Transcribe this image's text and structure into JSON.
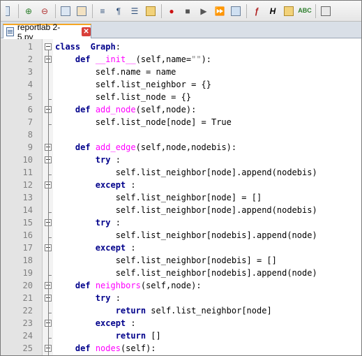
{
  "tab": {
    "filename": "reportlab 2-5.py",
    "close_glyph": "✕"
  },
  "toolbar_icons": [
    "save-all-icon",
    "zoom-in-icon",
    "zoom-out-icon",
    "sync-vertical-icon",
    "sync-horizontal-icon",
    "word-wrap-icon",
    "show-symbols-icon",
    "indent-guide-icon",
    "folder-icon",
    "record-macro-icon",
    "stop-macro-icon",
    "play-macro-icon",
    "run-macro-multiple-icon",
    "save-macro-icon",
    "function-list-icon",
    "highlight-icon",
    "open-folder-icon",
    "spellcheck-icon",
    "print-icon"
  ],
  "colors": {
    "keyword": "#00008b",
    "function": "#ff00ff",
    "string": "#808080",
    "gutter": "#e4e4e4",
    "accent_tab": "#f5a623"
  },
  "lines": [
    {
      "n": "1",
      "segs": [
        [
          "kw",
          "class"
        ],
        [
          "",
          "  "
        ],
        [
          "kw",
          "Graph"
        ],
        [
          "",
          ":"
        ]
      ]
    },
    {
      "n": "2",
      "segs": [
        [
          "",
          "    "
        ],
        [
          "kw",
          "def"
        ],
        [
          "",
          " "
        ],
        [
          "fn",
          "__init__"
        ],
        [
          "",
          "(self,name="
        ],
        [
          "st",
          "\"\""
        ],
        [
          "",
          "):"
        ]
      ]
    },
    {
      "n": "3",
      "segs": [
        [
          "",
          "        self.name = name"
        ]
      ]
    },
    {
      "n": "4",
      "segs": [
        [
          "",
          "        self.list_neighbor = {}"
        ]
      ]
    },
    {
      "n": "5",
      "segs": [
        [
          "",
          "        self.list_node = {}"
        ]
      ]
    },
    {
      "n": "6",
      "segs": [
        [
          "",
          "    "
        ],
        [
          "kw",
          "def"
        ],
        [
          "",
          " "
        ],
        [
          "fn",
          "add_node"
        ],
        [
          "",
          "(self,node):"
        ]
      ]
    },
    {
      "n": "7",
      "segs": [
        [
          "",
          "        self.list_node[node] = True"
        ]
      ]
    },
    {
      "n": "8",
      "segs": [
        [
          "",
          ""
        ]
      ]
    },
    {
      "n": "9",
      "segs": [
        [
          "",
          "    "
        ],
        [
          "kw",
          "def"
        ],
        [
          "",
          " "
        ],
        [
          "fn",
          "add_edge"
        ],
        [
          "",
          "(self,node,nodebis):"
        ]
      ]
    },
    {
      "n": "10",
      "segs": [
        [
          "",
          "        "
        ],
        [
          "kw",
          "try"
        ],
        [
          "",
          " :"
        ]
      ]
    },
    {
      "n": "11",
      "segs": [
        [
          "",
          "            self.list_neighbor[node].append(nodebis)"
        ]
      ]
    },
    {
      "n": "12",
      "segs": [
        [
          "",
          "        "
        ],
        [
          "kw",
          "except"
        ],
        [
          "",
          " :"
        ]
      ]
    },
    {
      "n": "13",
      "segs": [
        [
          "",
          "            self.list_neighbor[node] = []"
        ]
      ]
    },
    {
      "n": "14",
      "segs": [
        [
          "",
          "            self.list_neighbor[node].append(nodebis)"
        ]
      ]
    },
    {
      "n": "15",
      "segs": [
        [
          "",
          "        "
        ],
        [
          "kw",
          "try"
        ],
        [
          "",
          " :"
        ]
      ]
    },
    {
      "n": "16",
      "segs": [
        [
          "",
          "            self.list_neighbor[nodebis].append(node)"
        ]
      ]
    },
    {
      "n": "17",
      "segs": [
        [
          "",
          "        "
        ],
        [
          "kw",
          "except"
        ],
        [
          "",
          " :"
        ]
      ]
    },
    {
      "n": "18",
      "segs": [
        [
          "",
          "            self.list_neighbor[nodebis] = []"
        ]
      ]
    },
    {
      "n": "19",
      "segs": [
        [
          "",
          "            self.list_neighbor[nodebis].append(node)"
        ]
      ]
    },
    {
      "n": "20",
      "segs": [
        [
          "",
          "    "
        ],
        [
          "kw",
          "def"
        ],
        [
          "",
          " "
        ],
        [
          "fn",
          "neighbors"
        ],
        [
          "",
          "(self,node):"
        ]
      ]
    },
    {
      "n": "21",
      "segs": [
        [
          "",
          "        "
        ],
        [
          "kw",
          "try"
        ],
        [
          "",
          " :"
        ]
      ]
    },
    {
      "n": "22",
      "segs": [
        [
          "",
          "            "
        ],
        [
          "kw",
          "return"
        ],
        [
          "",
          " self.list_neighbor[node]"
        ]
      ]
    },
    {
      "n": "23",
      "segs": [
        [
          "",
          "        "
        ],
        [
          "kw",
          "except"
        ],
        [
          "",
          " :"
        ]
      ]
    },
    {
      "n": "24",
      "segs": [
        [
          "",
          "            "
        ],
        [
          "kw",
          "return"
        ],
        [
          "",
          " []"
        ]
      ]
    },
    {
      "n": "25",
      "segs": [
        [
          "",
          "    "
        ],
        [
          "kw",
          "def"
        ],
        [
          "",
          " "
        ],
        [
          "fn",
          "nodes"
        ],
        [
          "",
          "(self):"
        ]
      ]
    }
  ]
}
